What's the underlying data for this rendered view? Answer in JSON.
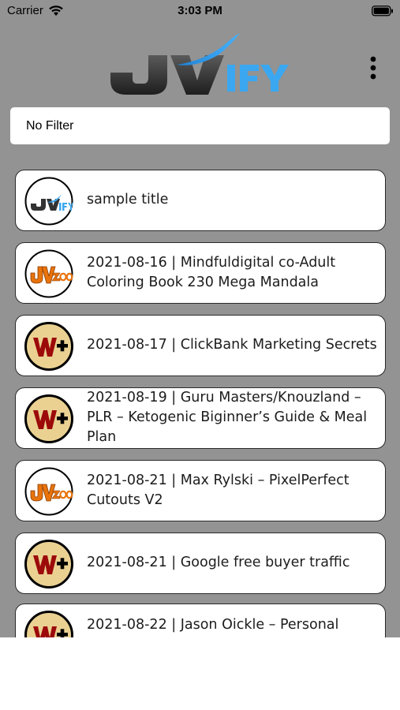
{
  "status_bar": {
    "carrier": "Carrier",
    "time": "3:03 PM"
  },
  "header": {
    "logo_text": "JVIFY",
    "menu_icon": "more-vertical-icon"
  },
  "filter": {
    "value": "No Filter"
  },
  "colors": {
    "background": "#939393",
    "logo_blue": "#3aa7f0",
    "logo_dark": "#3a3a3a",
    "jvzoo_orange": "#e8730c",
    "warrior_red": "#9c0a0a",
    "warrior_bg": "#ead192"
  },
  "items": [
    {
      "title": "sample title",
      "avatar": "jvify-logo"
    },
    {
      "title": "2021-08-16 | Mindfuldigital co-Adult Coloring Book 230 Mega Mandala",
      "avatar": "jvzoo-logo"
    },
    {
      "title": "2021-08-17 | ClickBank Marketing Secrets",
      "avatar": "warrior-plus-logo"
    },
    {
      "title": "2021-08-19 | Guru Masters/Knouzland – PLR – Ketogenic Biginner’s Guide & Meal Plan",
      "avatar": "warrior-plus-logo"
    },
    {
      "title": "2021-08-21 | Max Rylski – PixelPerfect Cutouts V2",
      "avatar": "jvzoo-logo"
    },
    {
      "title": "2021-08-21 | Google free buyer traffic",
      "avatar": "warrior-plus-logo"
    },
    {
      "title": "2021-08-22 | Jason Oickle – Personal",
      "avatar": "warrior-plus-logo"
    }
  ]
}
